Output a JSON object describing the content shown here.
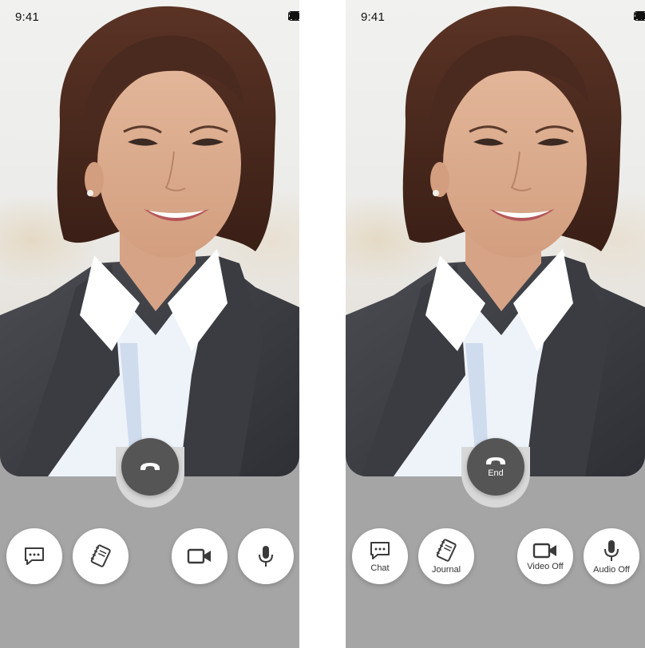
{
  "status_bar": {
    "time": "9:41"
  },
  "colors": {
    "end_button": "#555555",
    "bottom_panel": "#a5a5a5",
    "control_bg": "#ffffff"
  },
  "screens": [
    {
      "variant": "icons-only",
      "end_button": {
        "icon": "phone-hangup-icon",
        "label": ""
      },
      "controls": [
        {
          "icon": "chat-icon",
          "label": ""
        },
        {
          "icon": "journal-icon",
          "label": ""
        },
        {
          "icon": "video-camera-icon",
          "label": ""
        },
        {
          "icon": "microphone-icon",
          "label": ""
        }
      ]
    },
    {
      "variant": "labeled",
      "end_button": {
        "icon": "phone-hangup-icon",
        "label": "End"
      },
      "controls": [
        {
          "icon": "chat-icon",
          "label": "Chat"
        },
        {
          "icon": "journal-icon",
          "label": "Journal"
        },
        {
          "icon": "video-camera-icon",
          "label": "Video Off"
        },
        {
          "icon": "microphone-icon",
          "label": "Audio Off"
        }
      ]
    }
  ]
}
